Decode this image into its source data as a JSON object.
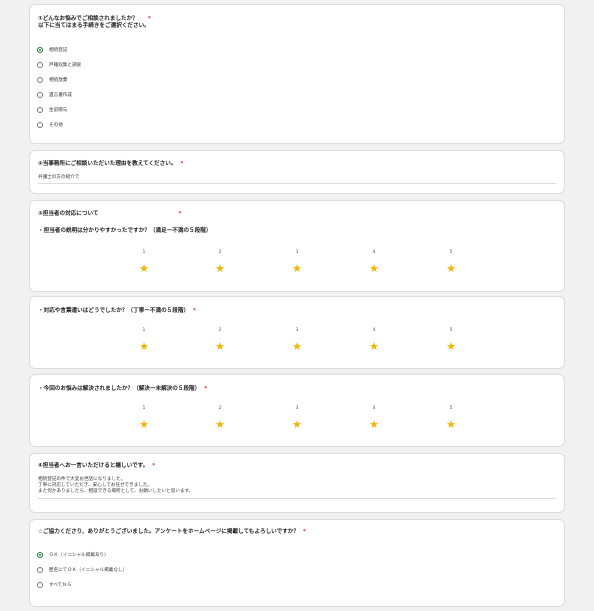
{
  "q1": {
    "title": "①どんなお悩みでご相談されましたか？",
    "required_mark": "*",
    "subtitle": "以下に当てはまる手続きをご選択ください。",
    "options": [
      "相続登記",
      "戸籍収集と調査",
      "相続放棄",
      "遺言書作成",
      "生前贈与",
      "その他"
    ],
    "selected_index": 0
  },
  "q2": {
    "title": "②当事務所にご相談いただいた理由を教えてください。",
    "required_mark": "*",
    "answer": "弁護士の方の紹介で"
  },
  "q3": {
    "title": "③担当者の対応について",
    "required_mark": "*",
    "scale_labels": [
      "1",
      "2",
      "3",
      "4",
      "5"
    ],
    "star_icon": "★",
    "sub1": "・担当者の説明は分かりやすかったですか？（満足ー不満の５段階）",
    "sub2": "・対応や言葉遣いはどうでしたか？（丁寧ー不満の５段階）",
    "sub2_required": "*",
    "sub3": "・今回のお悩みは解決されましたか？（解決ー未解決の５段階）",
    "sub3_required": "*"
  },
  "q4": {
    "title": "④担当者へお一言いただけると嬉しいです。",
    "required_mark": "*",
    "answer_lines": [
      "相続登記の件で大変お世話になりました。",
      "丁寧に対応していただき、安心してお任せできました。",
      "また何かありましたら、相談できる場所として、お願いしたいと思います。"
    ]
  },
  "q5": {
    "title": "☆ご協力くださり、ありがとうございました。アンケートをホームページに掲載してもよろしいですか？",
    "required_mark": "*",
    "options": [
      "ＯＫ（イニシャル掲載あり）",
      "匿名にてＯＫ（イニシャル掲載なし）",
      "すべてＮＧ"
    ],
    "selected_index": 0
  },
  "colors": {
    "accent_green": "#188038",
    "required_red": "#d93025",
    "star_yellow": "#f4b400"
  }
}
